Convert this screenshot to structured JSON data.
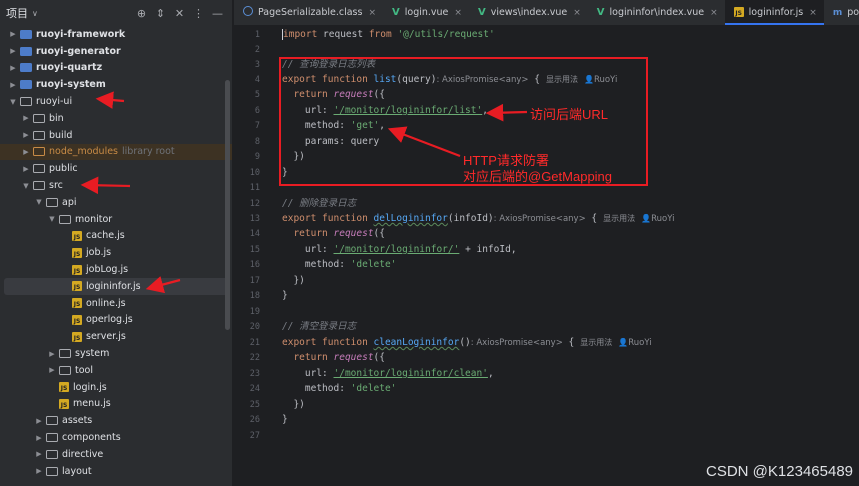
{
  "sidebar": {
    "title": "项目",
    "items": [
      {
        "label": "ruoyi-framework",
        "depth": 1,
        "kind": "module",
        "open": false
      },
      {
        "label": "ruoyi-generator",
        "depth": 1,
        "kind": "module",
        "open": false
      },
      {
        "label": "ruoyi-quartz",
        "depth": 1,
        "kind": "module",
        "open": false
      },
      {
        "label": "ruoyi-system",
        "depth": 1,
        "kind": "module",
        "open": false
      },
      {
        "label": "ruoyi-ui",
        "depth": 1,
        "kind": "folder",
        "open": true
      },
      {
        "label": "bin",
        "depth": 2,
        "kind": "folder",
        "open": false
      },
      {
        "label": "build",
        "depth": 2,
        "kind": "folder",
        "open": false
      },
      {
        "label": "node_modules",
        "depth": 2,
        "kind": "excluded",
        "open": false,
        "note": "library root"
      },
      {
        "label": "public",
        "depth": 2,
        "kind": "folder",
        "open": false
      },
      {
        "label": "src",
        "depth": 2,
        "kind": "folder",
        "open": true
      },
      {
        "label": "api",
        "depth": 3,
        "kind": "folder",
        "open": true
      },
      {
        "label": "monitor",
        "depth": 4,
        "kind": "folder",
        "open": true
      },
      {
        "label": "cache.js",
        "depth": 5,
        "kind": "js"
      },
      {
        "label": "job.js",
        "depth": 5,
        "kind": "js"
      },
      {
        "label": "jobLog.js",
        "depth": 5,
        "kind": "js"
      },
      {
        "label": "logininfor.js",
        "depth": 5,
        "kind": "js",
        "selected": true
      },
      {
        "label": "online.js",
        "depth": 5,
        "kind": "js"
      },
      {
        "label": "operlog.js",
        "depth": 5,
        "kind": "js"
      },
      {
        "label": "server.js",
        "depth": 5,
        "kind": "js"
      },
      {
        "label": "system",
        "depth": 4,
        "kind": "folder",
        "open": false
      },
      {
        "label": "tool",
        "depth": 4,
        "kind": "folder",
        "open": false
      },
      {
        "label": "login.js",
        "depth": 4,
        "kind": "js"
      },
      {
        "label": "menu.js",
        "depth": 4,
        "kind": "js"
      },
      {
        "label": "assets",
        "depth": 3,
        "kind": "folder",
        "open": false
      },
      {
        "label": "components",
        "depth": 3,
        "kind": "folder",
        "open": false
      },
      {
        "label": "directive",
        "depth": 3,
        "kind": "folder",
        "open": false
      },
      {
        "label": "layout",
        "depth": 3,
        "kind": "folder",
        "open": false
      }
    ]
  },
  "tabs": [
    {
      "label": "PageSerializable.class",
      "icon": "class-icon",
      "active": false
    },
    {
      "label": "login.vue",
      "icon": "vue-icon",
      "active": false
    },
    {
      "label": "views\\index.vue",
      "icon": "vue-icon",
      "active": false
    },
    {
      "label": "logininfor\\index.vue",
      "icon": "vue-icon",
      "active": false
    },
    {
      "label": "logininfor.js",
      "icon": "js-icon",
      "active": true
    },
    {
      "label": "pom.xml (ruoyi-f",
      "icon": "maven-icon",
      "active": false
    }
  ],
  "editor": {
    "line_numbers": [
      "1",
      "2",
      "3",
      "4",
      "5",
      "6",
      "7",
      "8",
      "9",
      "10",
      "11",
      "12",
      "13",
      "14",
      "15",
      "16",
      "17",
      "18",
      "19",
      "20",
      "21",
      "22",
      "23",
      "24",
      "25",
      "26",
      "27"
    ],
    "import_kw": "import",
    "import_rest_a": " request ",
    "import_from": "from",
    "import_path": "'@/utils/request'",
    "c1": "// 查询登录日志列表",
    "c2": "// 删除登录日志",
    "c3": "// 清空登录日志",
    "export_function": "export function ",
    "fn1": "list",
    "fn1_args": "(query)",
    "fn2": "delLogininfor",
    "fn2_args": "(infoId)",
    "fn3": "cleanLogininfor",
    "fn3_args": "()",
    "type_hint": ": AxiosPromise<any>",
    "brace_open": " {",
    "usage_hint": "显示用法",
    "author_hint": "RuoYi",
    "return_kw": "return ",
    "request_call": "request",
    "paren_open": "({",
    "url_key": "url: ",
    "url1": "'/monitor/logininfor/list'",
    "url2": "'/monitor/logininfor/'",
    "url2_tail": " + infoId,",
    "url3": "'/monitor/logininfor/clean'",
    "comma": ",",
    "method_key": "method: ",
    "m_get": "'get'",
    "m_delete": "'delete'",
    "params_line": "params: query",
    "close_paren": "})",
    "close_brace": "}"
  },
  "annotations": {
    "url_note": "访问后端URL",
    "http_note_1": "HTTP请求防署",
    "http_note_2": "对应后端的@GetMapping"
  },
  "watermark": "CSDN @K123465489",
  "colors": {
    "accent": "#3574f0",
    "annotation_red": "#e81c23",
    "string_green": "#6aab73",
    "keyword_orange": "#cf8e6d",
    "function_blue": "#56a8f5"
  }
}
